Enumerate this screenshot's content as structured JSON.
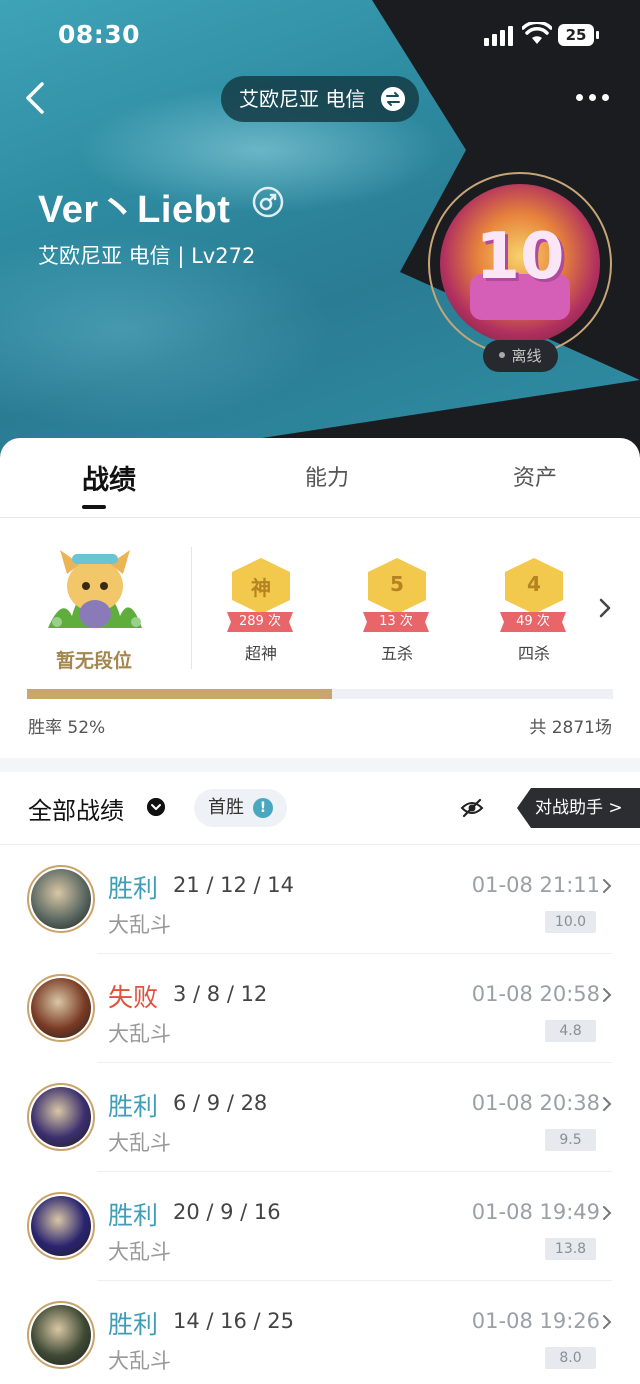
{
  "status_bar": {
    "time": "08:30",
    "battery": "25"
  },
  "header": {
    "region": "艾欧尼亚  电信",
    "player_name": "Ver丶Liebt",
    "player_sub": "艾欧尼亚  电信 | Lv272",
    "avatar_text": "10",
    "online_status": "离线"
  },
  "tabs": [
    {
      "label": "战绩",
      "active": true
    },
    {
      "label": "能力",
      "active": false
    },
    {
      "label": "资产",
      "active": false
    }
  ],
  "stats": {
    "rank_label": "暂无段位",
    "badges": [
      {
        "char": "神",
        "count": "289 次",
        "label": "超神"
      },
      {
        "char": "5",
        "count": "13 次",
        "label": "五杀"
      },
      {
        "char": "4",
        "count": "49 次",
        "label": "四杀"
      }
    ],
    "win_rate_fraction": 0.52,
    "win_rate_text": "胜率 52%",
    "total_text": "共 2871场"
  },
  "filter": {
    "all_records": "全部战绩",
    "first_win": "首胜",
    "first_win_info": "!",
    "assistant": "对战助手 >"
  },
  "matches": [
    {
      "result": "胜利",
      "outcome": "win",
      "kda": "21 / 12 / 14",
      "mode": "大乱斗",
      "time": "01-08 21:11",
      "score": "10.0",
      "champ_color": "#5d6a63"
    },
    {
      "result": "失败",
      "outcome": "lose",
      "kda": "3 / 8 / 12",
      "mode": "大乱斗",
      "time": "01-08 20:58",
      "score": "4.8",
      "champ_color": "#7a3b25"
    },
    {
      "result": "胜利",
      "outcome": "win",
      "kda": "6 / 9 / 28",
      "mode": "大乱斗",
      "time": "01-08 20:38",
      "score": "9.5",
      "champ_color": "#3b2f6e"
    },
    {
      "result": "胜利",
      "outcome": "win",
      "kda": "20 / 9 / 16",
      "mode": "大乱斗",
      "time": "01-08 19:49",
      "score": "13.8",
      "champ_color": "#2a2470"
    },
    {
      "result": "胜利",
      "outcome": "win",
      "kda": "14 / 16 / 25",
      "mode": "大乱斗",
      "time": "01-08 19:26",
      "score": "8.0",
      "champ_color": "#3f4a35"
    }
  ],
  "colors": {
    "win": "#3f9db8",
    "lose": "#e2513c",
    "gold": "#c9a66d",
    "hero_teal": "#2d8aa0",
    "hero_dark": "#1a1c1f"
  }
}
